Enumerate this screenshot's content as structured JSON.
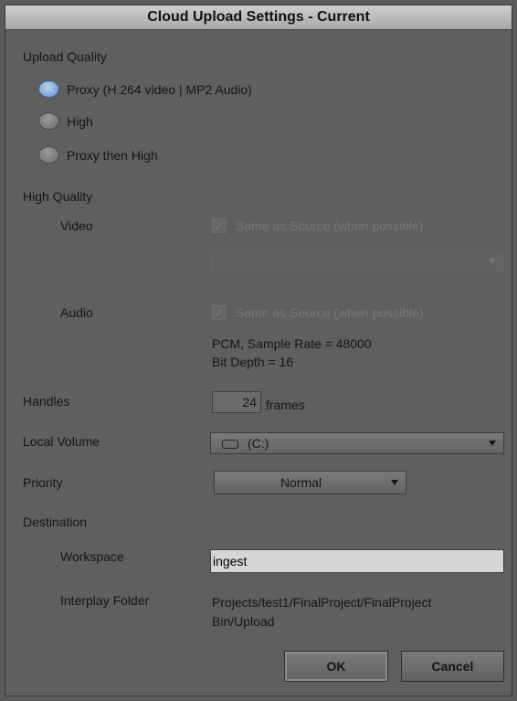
{
  "dialog": {
    "title": "Cloud Upload Settings - Current"
  },
  "upload_quality": {
    "heading": "Upload Quality",
    "options": [
      {
        "label": "Proxy (H.264 video | MP2 Audio)",
        "selected": true
      },
      {
        "label": "High",
        "selected": false
      },
      {
        "label": "Proxy then High",
        "selected": false
      }
    ]
  },
  "high_quality": {
    "heading": "High Quality",
    "video_label": "Video",
    "video_same_as_source": "Same as Source (when possible)",
    "video_format_value": "",
    "audio_label": "Audio",
    "audio_same_as_source": "Same as Source (when possible)",
    "audio_info_line1": "PCM, Sample Rate = 48000",
    "audio_info_line2": "Bit Depth = 16"
  },
  "handles": {
    "label": "Handles",
    "value": "24",
    "unit": "frames"
  },
  "local_volume": {
    "label": "Local Volume",
    "value": "(C:)"
  },
  "priority": {
    "label": "Priority",
    "value": "Normal"
  },
  "destination": {
    "heading": "Destination",
    "workspace_label": "Workspace",
    "workspace_value": "ingest",
    "folder_label": "Interplay Folder",
    "folder_line1": "Projects/test1/FinalProject/FinalProject",
    "folder_line2": "Bin/Upload"
  },
  "buttons": {
    "ok": "OK",
    "cancel": "Cancel"
  }
}
